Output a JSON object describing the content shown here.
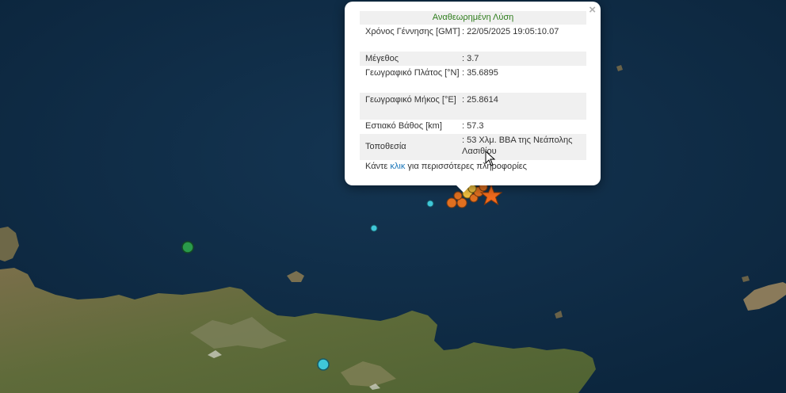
{
  "map": {
    "sea_color": "#0e2b45",
    "land_color": "#6b6a40",
    "events": [
      {
        "color": "#2a9a4a",
        "size": "M"
      },
      {
        "color": "#3fc7d8",
        "size": "M"
      },
      {
        "color": "#3fc7d8",
        "size": "S"
      },
      {
        "color": "#3fc7d8",
        "size": "S"
      },
      {
        "color": "#e07020",
        "size": "S"
      },
      {
        "color": "#f0c040",
        "size": "S"
      }
    ],
    "latest_marker": {
      "shape": "star-icon",
      "color": "#f26b1d"
    }
  },
  "popup": {
    "title": "Αναθεωρημένη Λύση",
    "close": "×",
    "rows": [
      {
        "label": "Χρόνος Γέννησης [GMT]",
        "value": ": 22/05/2025 19:05:10.07"
      },
      {
        "label": "Μέγεθος",
        "value": ": 3.7"
      },
      {
        "label": "Γεωγραφικό Πλάτος [°N]",
        "value": ": 35.6895"
      },
      {
        "label": "Γεωγραφικό Μήκος [°E]",
        "value": ": 25.8614"
      },
      {
        "label": "Εστιακό Βάθος [km]",
        "value": ": 57.3"
      },
      {
        "label": "Τοποθεσία",
        "value": ": 53 Χλμ. ΒΒΑ της Νεάπολης Λασιθίου"
      }
    ],
    "footer": {
      "prefix": "Κάντε ",
      "link": "κλικ",
      "suffix": " για περισσότερες πληροφορίες"
    }
  }
}
